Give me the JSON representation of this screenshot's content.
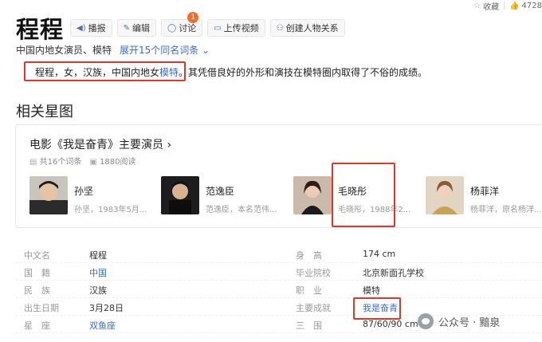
{
  "topbar": {
    "bookmark_label": "收藏",
    "like_count": "4728"
  },
  "entry": {
    "title": "程程"
  },
  "toolbar": {
    "broadcast": "播报",
    "edit": "编辑",
    "discuss": "讨论",
    "discuss_badge": "1",
    "upload_video": "上传视频",
    "create_relation": "创建人物关系"
  },
  "subtitle": {
    "description": "中国内地女演员、模特",
    "expand_link": "展开15个同名词条",
    "expand_icon": "chevron-down-icon"
  },
  "summary": {
    "highlighted_part": "程程，女，汉族，中国内地女",
    "link_word": "模特",
    "rest": "。其凭借良好的外形和演技在模特圈内取得了不俗的成绩。"
  },
  "section": {
    "title": "相关星图"
  },
  "star_card": {
    "title": "电影《我是奋青》主要演员",
    "chevron": "›",
    "entry_count": "共16个词条",
    "read_count": "1880阅读",
    "more_arrow": "<",
    "people": [
      {
        "name": "孙坚",
        "desc": "孙坚，1983年5月..."
      },
      {
        "name": "范逸臣",
        "desc": "范逸臣，本名范伟..."
      },
      {
        "name": "毛晓彤",
        "desc": "毛晓彤，1988年2..."
      },
      {
        "name": "杨菲洋",
        "desc": "杨菲洋，原名杨洋..."
      }
    ]
  },
  "basic_info": {
    "rows": [
      {
        "l1": "中文名",
        "v1": "程程",
        "l2": "身　高",
        "v2": "174 cm"
      },
      {
        "l1": "国　籍",
        "v1": "中国",
        "l2": "毕业院校",
        "v2": "北京新面孔学校"
      },
      {
        "l1": "民　族",
        "v1": "汉族",
        "l2": "职　业",
        "v2": "模特"
      },
      {
        "l1": "出生日期",
        "v1": "3月28日",
        "l2": "主要成就",
        "v2": "我是奋青"
      },
      {
        "l1": "星　座",
        "v1": "双鱼座",
        "l2": "三　围",
        "v2": "87/60/90 cm"
      }
    ]
  },
  "watermark": {
    "text": "公众号 · 黯泉"
  },
  "colors": {
    "link": "#3b6dbf",
    "highlight_box": "#d63a2f",
    "badge": "#f56c2b"
  }
}
